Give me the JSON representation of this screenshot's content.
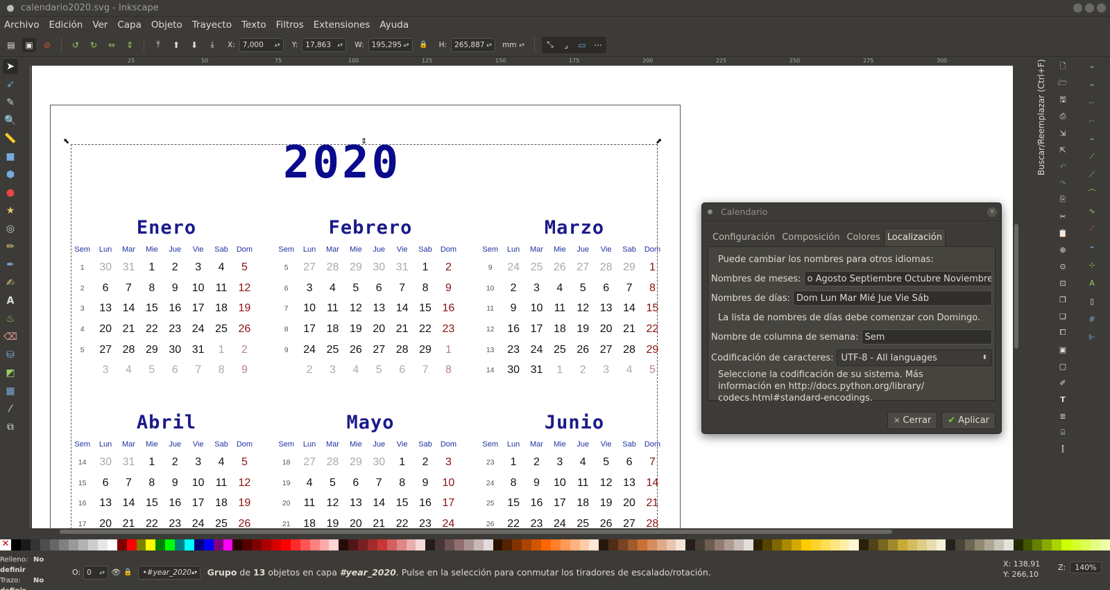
{
  "window": {
    "title": "calendario2020.svg - Inkscape"
  },
  "menu": [
    "Archivo",
    "Edición",
    "Ver",
    "Capa",
    "Objeto",
    "Trayecto",
    "Texto",
    "Filtros",
    "Extensiones",
    "Ayuda"
  ],
  "toolbar": {
    "x_label": "X:",
    "x": "7,000",
    "y_label": "Y:",
    "y": "17,863",
    "w_label": "W:",
    "w": "195,295",
    "h_label": "H:",
    "h": "265,887",
    "unit": "mm"
  },
  "ruler_h": [
    "25",
    "50",
    "75",
    "100",
    "125",
    "150",
    "175",
    "200",
    "225",
    "250",
    "275",
    "300"
  ],
  "calendar": {
    "year": "2020",
    "weekday_headers": [
      "Sem",
      "Lun",
      "Mar",
      "Mie",
      "Jue",
      "Vie",
      "Sab",
      "Dom"
    ],
    "months": [
      {
        "name": "Enero",
        "weeks": [
          [
            "1",
            "30",
            "31",
            "1",
            "2",
            "3",
            "4",
            "5"
          ],
          [
            "2",
            "6",
            "7",
            "8",
            "9",
            "10",
            "11",
            "12"
          ],
          [
            "3",
            "13",
            "14",
            "15",
            "16",
            "17",
            "18",
            "19"
          ],
          [
            "4",
            "20",
            "21",
            "22",
            "23",
            "24",
            "25",
            "26"
          ],
          [
            "5",
            "27",
            "28",
            "29",
            "30",
            "31",
            "1",
            "2"
          ],
          [
            "",
            "3",
            "4",
            "5",
            "6",
            "7",
            "8",
            "9"
          ]
        ]
      },
      {
        "name": "Febrero",
        "weeks": [
          [
            "5",
            "27",
            "28",
            "29",
            "30",
            "31",
            "1",
            "2"
          ],
          [
            "6",
            "3",
            "4",
            "5",
            "6",
            "7",
            "8",
            "9"
          ],
          [
            "7",
            "10",
            "11",
            "12",
            "13",
            "14",
            "15",
            "16"
          ],
          [
            "8",
            "17",
            "18",
            "19",
            "20",
            "21",
            "22",
            "23"
          ],
          [
            "9",
            "24",
            "25",
            "26",
            "27",
            "28",
            "29",
            "1"
          ],
          [
            "",
            "2",
            "3",
            "4",
            "5",
            "6",
            "7",
            "8"
          ]
        ]
      },
      {
        "name": "Marzo",
        "weeks": [
          [
            "9",
            "24",
            "25",
            "26",
            "27",
            "28",
            "29",
            "1"
          ],
          [
            "10",
            "2",
            "3",
            "4",
            "5",
            "6",
            "7",
            "8"
          ],
          [
            "11",
            "9",
            "10",
            "11",
            "12",
            "13",
            "14",
            "15"
          ],
          [
            "12",
            "16",
            "17",
            "18",
            "19",
            "20",
            "21",
            "22"
          ],
          [
            "13",
            "23",
            "24",
            "25",
            "26",
            "27",
            "28",
            "29"
          ],
          [
            "14",
            "30",
            "31",
            "1",
            "2",
            "3",
            "4",
            "5"
          ]
        ]
      },
      {
        "name": "Abril",
        "weeks": [
          [
            "14",
            "30",
            "31",
            "1",
            "2",
            "3",
            "4",
            "5"
          ],
          [
            "15",
            "6",
            "7",
            "8",
            "9",
            "10",
            "11",
            "12"
          ],
          [
            "16",
            "13",
            "14",
            "15",
            "16",
            "17",
            "18",
            "19"
          ],
          [
            "17",
            "20",
            "21",
            "22",
            "23",
            "24",
            "25",
            "26"
          ]
        ]
      },
      {
        "name": "Mayo",
        "weeks": [
          [
            "18",
            "27",
            "28",
            "29",
            "30",
            "1",
            "2",
            "3"
          ],
          [
            "19",
            "4",
            "5",
            "6",
            "7",
            "8",
            "9",
            "10"
          ],
          [
            "20",
            "11",
            "12",
            "13",
            "14",
            "15",
            "16",
            "17"
          ],
          [
            "21",
            "18",
            "19",
            "20",
            "21",
            "22",
            "23",
            "24"
          ]
        ]
      },
      {
        "name": "Junio",
        "weeks": [
          [
            "23",
            "1",
            "2",
            "3",
            "4",
            "5",
            "6",
            "7"
          ],
          [
            "24",
            "8",
            "9",
            "10",
            "11",
            "12",
            "13",
            "14"
          ],
          [
            "25",
            "15",
            "16",
            "17",
            "18",
            "19",
            "20",
            "21"
          ],
          [
            "26",
            "22",
            "23",
            "24",
            "25",
            "26",
            "27",
            "28"
          ]
        ]
      }
    ]
  },
  "dock": {
    "find_replace": "Buscar/Reemplazar (Ctrl+F)"
  },
  "dialog": {
    "title": "Calendario",
    "tabs": [
      "Configuración",
      "Composición",
      "Colores",
      "Localización"
    ],
    "intro": "Puede cambiar los nombres para otros idiomas:",
    "months_label": "Nombres de meses:",
    "months_value": "o Agosto Septiembre Octubre Noviembre Diciembre",
    "days_label": "Nombres de días:",
    "days_value": "Dom Lun Mar Mié Jue Vie Sáb",
    "days_note": "La lista de nombres de días debe comenzar con Domingo.",
    "week_col_label": "Nombre de columna de semana:",
    "week_col_value": "Sem",
    "encoding_label": "Codificación de caracteres:",
    "encoding_value": "UTF-8 - All languages",
    "encoding_note_1": "Seleccione la codificación de su sistema. Más",
    "encoding_note_2": "información en http://docs.python.org/library/",
    "encoding_note_3": "codecs.html#standard-encodings.",
    "close_label": "Cerrar",
    "apply_label": "Aplicar"
  },
  "status": {
    "fill_label": "Relleno:",
    "fill_value": "No definir",
    "stroke_label": "Trazo:",
    "stroke_value": "No definir",
    "opacity_label": "O:",
    "opacity_value": "0",
    "layer": "•#year_2020",
    "msg_1": "Grupo",
    "msg_2": " de ",
    "msg_3": "13",
    "msg_4": " objetos en capa ",
    "msg_5": "#year_2020",
    "msg_6": ". Pulse en la selección para conmutar los tiradores de escalado/rotación.",
    "x_coord": "X: 138,91",
    "y_coord": "Y: 266,10",
    "zoom_label": "Z:",
    "zoom": "140%"
  },
  "palette": [
    "#000000",
    "#1a1a1a",
    "#333333",
    "#4d4d4d",
    "#666666",
    "#808080",
    "#999999",
    "#b3b3b3",
    "#cccccc",
    "#e6e6e6",
    "#ffffff",
    "#800000",
    "#ff0000",
    "#808000",
    "#ffff00",
    "#008000",
    "#00ff00",
    "#008080",
    "#00ffff",
    "#000080",
    "#0000ff",
    "#800080",
    "#ff00ff",
    "#2b0000",
    "#550000",
    "#800000",
    "#aa0000",
    "#d40000",
    "#ff0000",
    "#ff2a2a",
    "#ff5555",
    "#ff8080",
    "#ffaaaa",
    "#ffd5d5",
    "#280b0b",
    "#501616",
    "#782121",
    "#a02c2c",
    "#c83737",
    "#d35f5f",
    "#de8787",
    "#e9afaf",
    "#f4d7d7",
    "#241c1c",
    "#483737",
    "#6c5353",
    "#916f6f",
    "#ac9393",
    "#c8b7b7",
    "#e3dbdb",
    "#2b1100",
    "#552200",
    "#803300",
    "#aa4400",
    "#d45500",
    "#ff6600",
    "#ff7f2a",
    "#ff9955",
    "#ffb380",
    "#ffccaa",
    "#ffe6d5",
    "#28170b",
    "#502d16",
    "#784421",
    "#a05a2c",
    "#c87137",
    "#d38d5f",
    "#deaa87",
    "#e9c6af",
    "#f4e3d7",
    "#241f1c",
    "#483e37",
    "#6c5d53",
    "#917c6f",
    "#ac9d93",
    "#c8beb7",
    "#e3dedb",
    "#2b2200",
    "#554400",
    "#806600",
    "#aa8800",
    "#d4aa00",
    "#ffcc00",
    "#ffd42a",
    "#ffdd55",
    "#ffe680",
    "#ffeeaa",
    "#fff6d5",
    "#28220b",
    "#504416",
    "#786721",
    "#a0892c",
    "#c8ab37",
    "#d3bc5f",
    "#decd87",
    "#e9ddaf",
    "#f4eed7",
    "#24221c",
    "#484537",
    "#6c6753",
    "#918a6f",
    "#aca793",
    "#c8c4b7",
    "#e3e2db",
    "#222b00",
    "#445500",
    "#668000",
    "#88aa00",
    "#aad400",
    "#ccff00",
    "#d4ff2a",
    "#ddff55",
    "#e5ff80",
    "#eeffaa"
  ]
}
